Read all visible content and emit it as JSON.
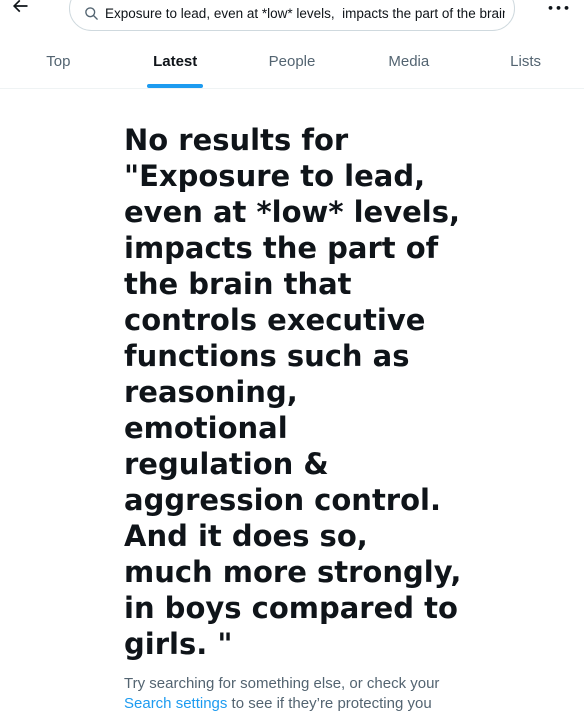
{
  "search": {
    "value": "Exposure to lead, even at *low* levels,  impacts the part of the brain that controls executive functions such as reasoning, emotional regulation & aggression control."
  },
  "icons": {
    "back": "arrow-left-icon",
    "search": "magnifier-icon",
    "more": "more-horizontal-icon"
  },
  "more_label": "•••",
  "tabs": [
    {
      "label": "Top",
      "active": false
    },
    {
      "label": "Latest",
      "active": true
    },
    {
      "label": "People",
      "active": false
    },
    {
      "label": "Media",
      "active": false
    },
    {
      "label": "Lists",
      "active": false
    }
  ],
  "empty_state": {
    "title": "No results for \"Exposure to lead, even at *low* levels, impacts the part of the brain that controls executive functions such as reasoning, emotional regulation & aggression control. And it does so, much more strongly, in boys compared to girls. \"",
    "subtitle_before": "Try searching for something else, or check your ",
    "subtitle_link": "Search settings",
    "subtitle_after": " to see if they’re protecting you"
  },
  "colors": {
    "accent": "#1d9bf0",
    "text_primary": "#0f1419",
    "text_secondary": "#536471",
    "border": "#cfd9de"
  }
}
